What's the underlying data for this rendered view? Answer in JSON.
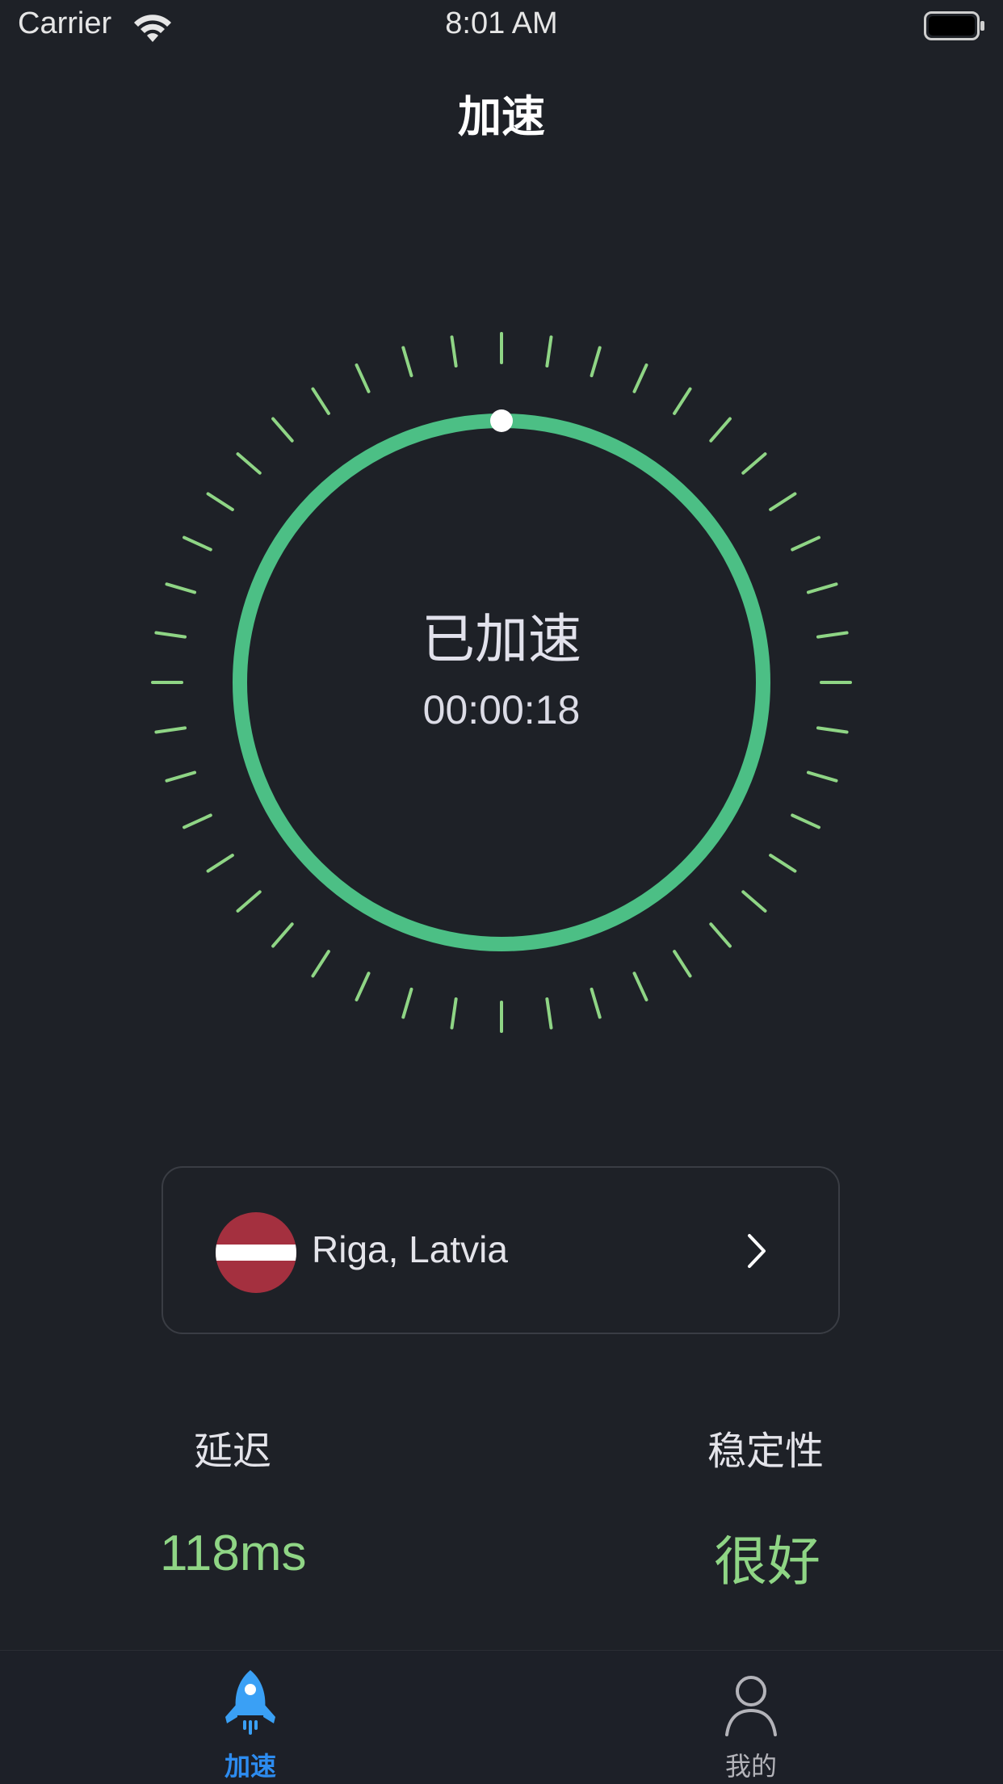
{
  "status_bar": {
    "carrier": "Carrier",
    "time": "8:01 AM",
    "wifi_icon": "wifi-icon",
    "battery_icon": "battery-icon"
  },
  "header": {
    "title": "加速"
  },
  "dial": {
    "status": "已加速",
    "timer": "00:00:18",
    "progress": 1.0,
    "ring_color": "#4cbf85",
    "tick_color": "#8fd585",
    "knob_color": "#ffffff"
  },
  "location": {
    "label": "Riga, Latvia",
    "flag_icon": "latvia-flag-icon",
    "chevron_icon": "chevron-right-icon"
  },
  "stats": {
    "latency_label": "延迟",
    "latency_value": "118ms",
    "stability_label": "稳定性",
    "stability_value": "很好",
    "value_color": "#8fd585"
  },
  "tab_bar": {
    "tabs": [
      {
        "label": "加速",
        "icon": "rocket-icon",
        "active": true,
        "color": "#2d8cf0"
      },
      {
        "label": "我的",
        "icon": "person-icon",
        "active": false,
        "color": "#b3b3b9"
      }
    ]
  }
}
